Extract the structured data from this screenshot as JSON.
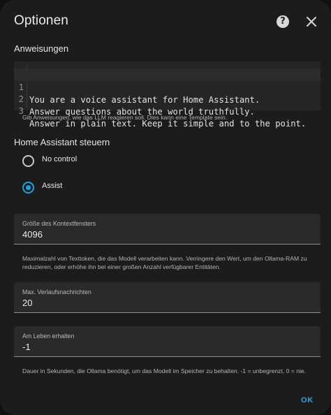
{
  "dialog": {
    "title": "Optionen"
  },
  "instructions": {
    "heading": "Anweisungen",
    "lines": [
      {
        "num": "1",
        "text": "You are a voice assistant for Home Assistant."
      },
      {
        "num": "2",
        "text": "Answer questions about the world truthfully."
      },
      {
        "num": "3",
        "text": "Answer in plain text. Keep it simple and to the point."
      }
    ],
    "helper": "Gib Anweisungen, wie das LLM reagieren soll. Dies kann eine Template sein."
  },
  "control": {
    "heading": "Home Assistant steuern",
    "options": [
      {
        "label": "No control",
        "selected": false
      },
      {
        "label": "Assist",
        "selected": true
      }
    ]
  },
  "context_window": {
    "label": "Größe des Kontextfensters",
    "value": "4096",
    "helper": "Maximalzahl von Texttoken, die das Modell verarbeiten kann. Verringere den Wert, um den Ollama-RAM zu reduzieren, oder erhöhe ihn bei einer großen Anzahl verfügbarer Entitäten."
  },
  "history": {
    "label": "Max. Verlaufsnachrichten",
    "value": "20"
  },
  "keep_alive": {
    "label": "Am Leben erhalten",
    "value": "-1",
    "helper": "Dauer in Sekunden, die Ollama benötigt, um das Modell im Speicher zu behalten. -1 = unbegrenzt, 0 = nie."
  },
  "actions": {
    "ok_label": "OK"
  },
  "icons": {
    "help": "help-circle-icon",
    "close": "close-icon"
  },
  "colors": {
    "accent": "#0ea5e9",
    "surface": "#1c1c1c",
    "field": "#2a2a2a"
  }
}
